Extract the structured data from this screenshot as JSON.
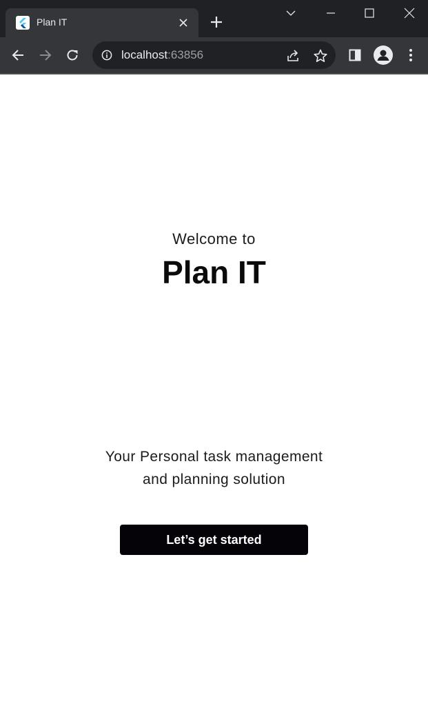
{
  "browser": {
    "tab": {
      "title": "Plan IT"
    },
    "address": {
      "host": "localhost",
      "port": ":63856"
    },
    "icons": {
      "favicon": "flutter-logo-icon",
      "tab_close": "close-icon",
      "new_tab": "plus-icon",
      "tab_search": "chevron-down-icon",
      "minimize": "minimize-icon",
      "maximize": "maximize-icon",
      "close_window": "close-icon",
      "back": "arrow-left-icon",
      "forward": "arrow-right-icon",
      "reload": "reload-icon",
      "site_info": "info-icon",
      "share": "share-icon",
      "bookmark": "star-icon",
      "side_panel": "side-panel-icon",
      "profile": "person-icon",
      "menu": "kebab-menu-icon"
    },
    "colors": {
      "tabstrip": "#202124",
      "toolbar": "#35363a",
      "text": "#e8eaed",
      "muted": "#9aa0a6"
    }
  },
  "page": {
    "welcome": "Welcome to",
    "title": "Plan IT",
    "tagline_line1": "Your Personal task management",
    "tagline_line2": "and planning solution",
    "cta_label": "Let’s get started",
    "colors": {
      "background": "#ffffff",
      "button": "#050308",
      "button_text": "#ffffff"
    }
  }
}
